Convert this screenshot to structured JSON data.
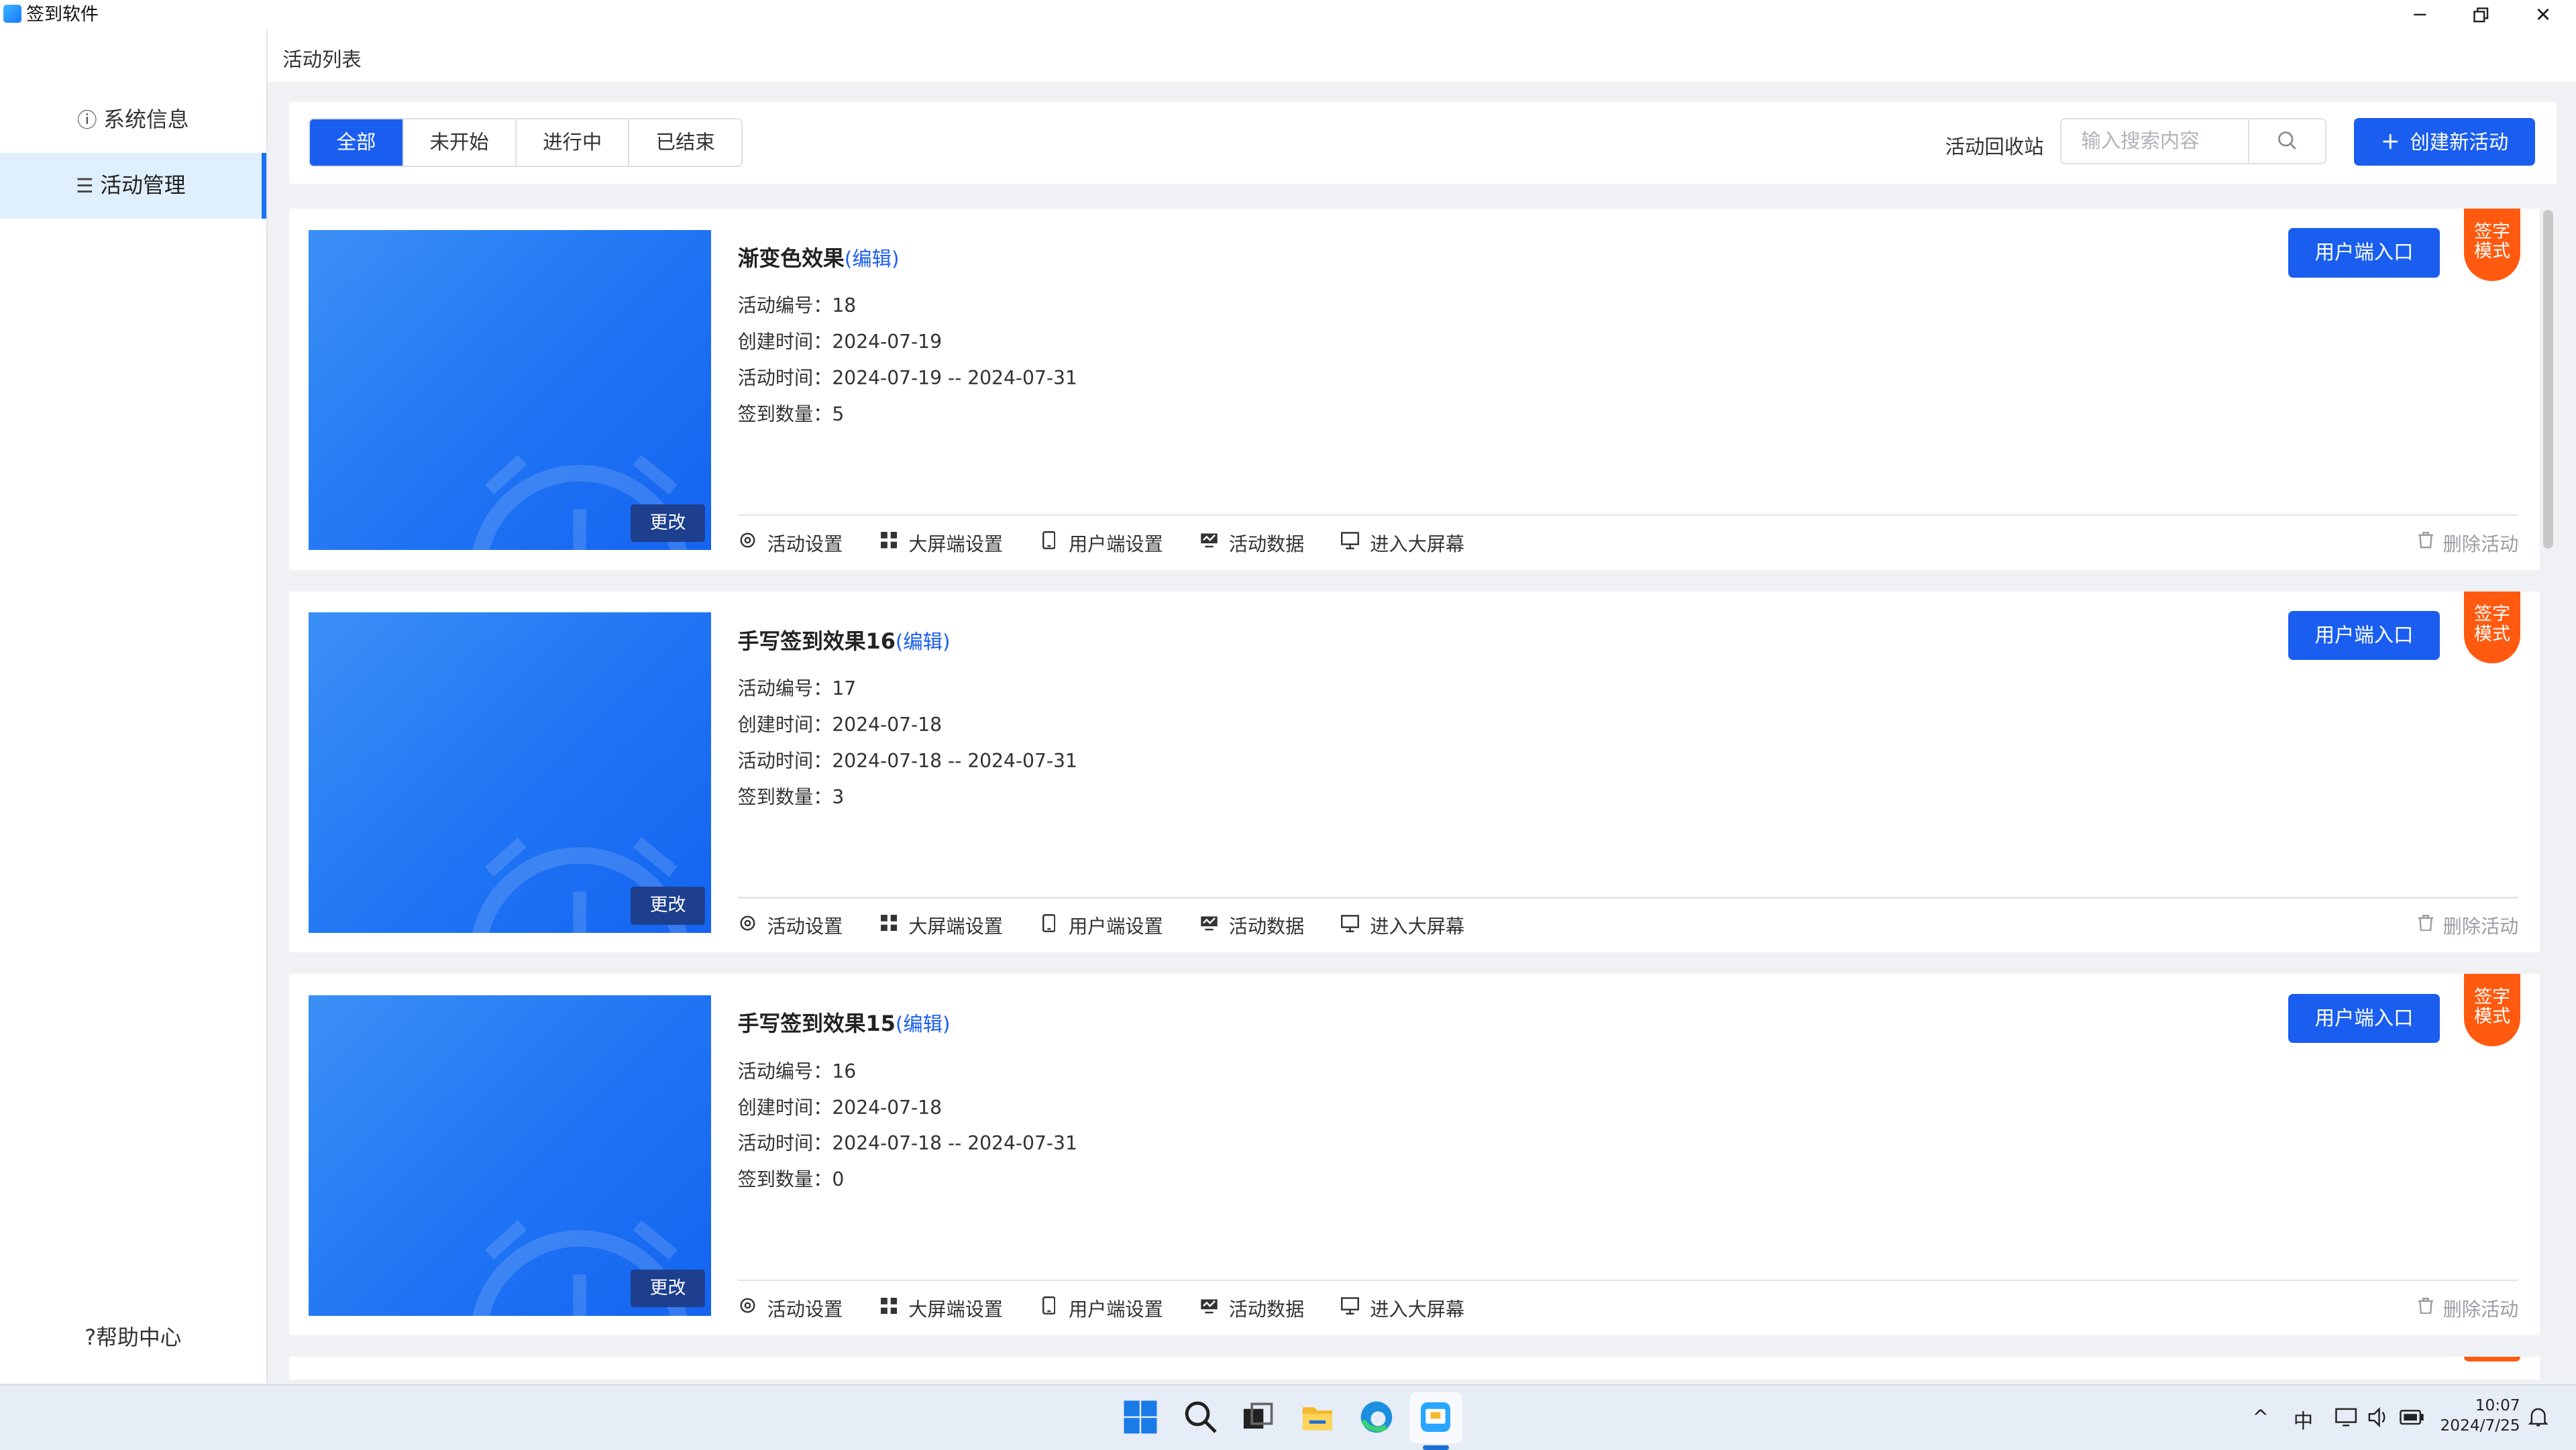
{
  "window": {
    "title": "签到软件",
    "min_icon": "minimize-icon",
    "max_icon": "restore-icon",
    "close_icon": "close-icon"
  },
  "sidebar": {
    "items": [
      {
        "label": "系统信息",
        "icon": "info-circle-icon",
        "active": false
      },
      {
        "label": "活动管理",
        "icon": "menu-list-icon",
        "active": true
      }
    ],
    "help": "帮助中心"
  },
  "breadcrumb": "活动列表",
  "filters": {
    "tabs": [
      "全部",
      "未开始",
      "进行中",
      "已结束"
    ],
    "active": 0,
    "recycle": "活动回收站",
    "search_placeholder": "输入搜索内容",
    "create_label": "创建新活动"
  },
  "labels": {
    "edit": "(编辑)",
    "id": "活动编号：",
    "created": "创建时间：",
    "period": "活动时间：",
    "count": "签到数量：",
    "change": "更改",
    "user_entry": "用户端入口",
    "badge_line1": "签字",
    "badge_line2": "模式",
    "delete": "删除活动"
  },
  "actions": [
    {
      "label": "活动设置",
      "icon": "gear-icon"
    },
    {
      "label": "大屏端设置",
      "icon": "grid-icon"
    },
    {
      "label": "用户端设置",
      "icon": "mobile-icon"
    },
    {
      "label": "活动数据",
      "icon": "chart-icon"
    },
    {
      "label": "进入大屏幕",
      "icon": "monitor-icon"
    }
  ],
  "activities": [
    {
      "name": "渐变色效果",
      "id": "18",
      "created": "2024-07-19",
      "period": "2024-07-19 -- 2024-07-31",
      "count": "5"
    },
    {
      "name": "手写签到效果16",
      "id": "17",
      "created": "2024-07-18",
      "period": "2024-07-18 -- 2024-07-31",
      "count": "3"
    },
    {
      "name": "手写签到效果15",
      "id": "16",
      "created": "2024-07-18",
      "period": "2024-07-18 -- 2024-07-31",
      "count": "0"
    }
  ],
  "taskbar": {
    "ime": "中",
    "time": "10:07",
    "date": "2024/7/25"
  },
  "colors": {
    "primary": "#1a5ef0",
    "badge": "#ff5a0f",
    "sidebar_active": "#e0effc"
  }
}
